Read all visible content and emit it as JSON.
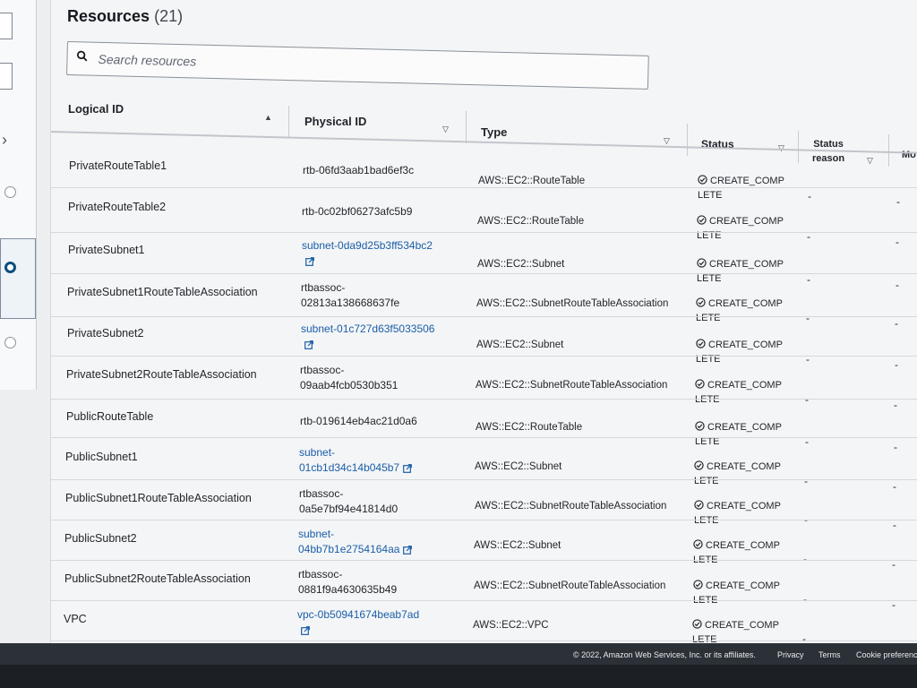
{
  "resources": {
    "title": "Resources",
    "count": "(21)",
    "search_placeholder": "Search resources"
  },
  "columns": {
    "logical_id": "Logical ID",
    "physical_id": "Physical ID",
    "type": "Type",
    "status": "Status",
    "status_reason_1": "Status",
    "status_reason_2": "reason",
    "module": "Mo"
  },
  "rows": [
    {
      "logical_id": "PrivateRouteTable1",
      "pid1": "rtb-06fd3aab1bad6ef3c",
      "pid2": "",
      "link": false,
      "type": "AWS::EC2::RouteTable",
      "s1": "CREATE_COMP",
      "s2": "LETE"
    },
    {
      "logical_id": "PrivateRouteTable2",
      "pid1": "rtb-0c02bf06273afc5b9",
      "pid2": "",
      "link": false,
      "type": "AWS::EC2::RouteTable",
      "s1": "CREATE_COMP",
      "s2": "LETE"
    },
    {
      "logical_id": "PrivateSubnet1",
      "pid1": "subnet-0da9d25b3ff534bc2",
      "pid2": "",
      "link": true,
      "type": "AWS::EC2::Subnet",
      "s1": "CREATE_COMP",
      "s2": "LETE"
    },
    {
      "logical_id": "PrivateSubnet1RouteTableAssociation",
      "pid1": "rtbassoc-",
      "pid2": "02813a138668637fe",
      "link": false,
      "type": "AWS::EC2::SubnetRouteTableAssociation",
      "s1": "CREATE_COMP",
      "s2": "LETE"
    },
    {
      "logical_id": "PrivateSubnet2",
      "pid1": "subnet-01c727d63f5033506",
      "pid2": "",
      "link": true,
      "type": "AWS::EC2::Subnet",
      "s1": "CREATE_COMP",
      "s2": "LETE"
    },
    {
      "logical_id": "PrivateSubnet2RouteTableAssociation",
      "pid1": "rtbassoc-",
      "pid2": "09aab4fcb0530b351",
      "link": false,
      "type": "AWS::EC2::SubnetRouteTableAssociation",
      "s1": "CREATE_COMP",
      "s2": "LETE"
    },
    {
      "logical_id": "PublicRouteTable",
      "pid1": "rtb-019614eb4ac21d0a6",
      "pid2": "",
      "link": false,
      "type": "AWS::EC2::RouteTable",
      "s1": "CREATE_COMP",
      "s2": "LETE"
    },
    {
      "logical_id": "PublicSubnet1",
      "pid1": "subnet-",
      "pid2": "01cb1d34c14b045b7",
      "link": true,
      "type": "AWS::EC2::Subnet",
      "s1": "CREATE_COMP",
      "s2": "LETE"
    },
    {
      "logical_id": "PublicSubnet1RouteTableAssociation",
      "pid1": "rtbassoc-",
      "pid2": "0a5e7bf94e41814d0",
      "link": false,
      "type": "AWS::EC2::SubnetRouteTableAssociation",
      "s1": "CREATE_COMP",
      "s2": "LETE"
    },
    {
      "logical_id": "PublicSubnet2",
      "pid1": "subnet-",
      "pid2": "04bb7b1e2754164aa",
      "link": true,
      "type": "AWS::EC2::Subnet",
      "s1": "CREATE_COMP",
      "s2": "LETE"
    },
    {
      "logical_id": "PublicSubnet2RouteTableAssociation",
      "pid1": "rtbassoc-",
      "pid2": "0881f9a4630635b49",
      "link": false,
      "type": "AWS::EC2::SubnetRouteTableAssociation",
      "s1": "CREATE_COMP",
      "s2": "LETE"
    },
    {
      "logical_id": "VPC",
      "pid1": "vpc-0b50941674beab7ad",
      "pid2": "",
      "link": true,
      "type": "AWS::EC2::VPC",
      "s1": "CREATE_COMP",
      "s2": "LETE"
    }
  ],
  "dash": "-",
  "footer": {
    "copyright": "© 2022, Amazon Web Services, Inc. or its affiliates.",
    "privacy": "Privacy",
    "terms": "Terms",
    "cookies": "Cookie preferences"
  },
  "colors": {
    "link": "#1a5ea8",
    "success": "#1d8102",
    "selected_radio": "#0b4f7c"
  }
}
